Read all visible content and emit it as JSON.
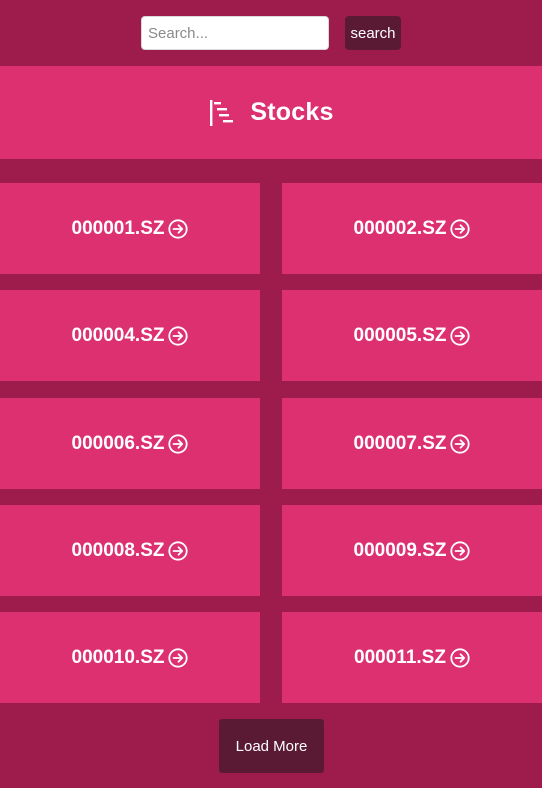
{
  "search": {
    "placeholder": "Search...",
    "value": "",
    "button_label": "search"
  },
  "header": {
    "title": "Stocks",
    "icon": "timeline-icon"
  },
  "stocks": [
    {
      "label": "000001.SZ"
    },
    {
      "label": "000002.SZ"
    },
    {
      "label": "000004.SZ"
    },
    {
      "label": "000005.SZ"
    },
    {
      "label": "000006.SZ"
    },
    {
      "label": "000007.SZ"
    },
    {
      "label": "000008.SZ"
    },
    {
      "label": "000009.SZ"
    },
    {
      "label": "000010.SZ"
    },
    {
      "label": "000011.SZ"
    }
  ],
  "tile_icon": "arrow-right-circle-icon",
  "load_more_label": "Load More",
  "colors": {
    "background": "#9e1c4c",
    "tile": "#dd3071",
    "button": "#5a1a33"
  }
}
